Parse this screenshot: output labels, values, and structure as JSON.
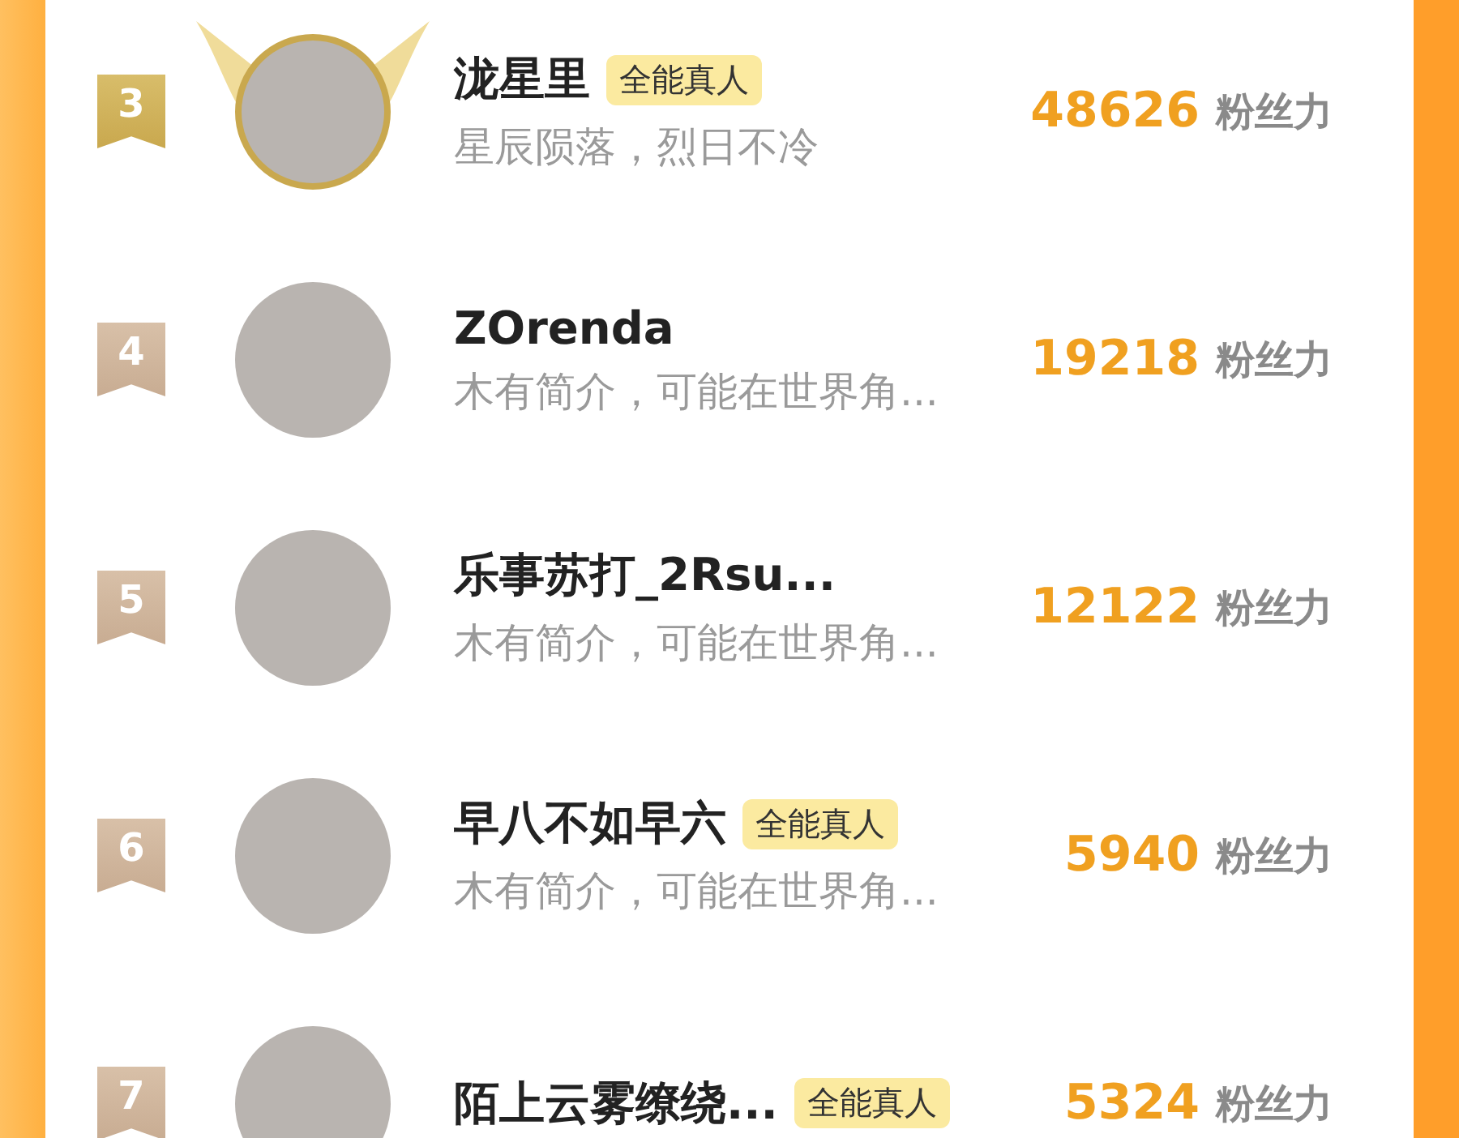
{
  "ranking": [
    {
      "rank": "3",
      "kind": "crowned",
      "name": "泷星里",
      "tag": "全能真人",
      "bio": "星辰陨落，烈日不冷",
      "score": "48626",
      "unit": "粉丝力"
    },
    {
      "rank": "4",
      "kind": "plain",
      "name": "ZOrenda",
      "bio": "木有简介，可能在世界角...",
      "score": "19218",
      "unit": "粉丝力"
    },
    {
      "rank": "5",
      "kind": "plain",
      "name": "乐事苏打_2Rsu...",
      "bio": "木有简介，可能在世界角...",
      "score": "12122",
      "unit": "粉丝力"
    },
    {
      "rank": "6",
      "kind": "plain",
      "name": "早八不如早六",
      "tag": "全能真人",
      "bio": "木有简介，可能在世界角...",
      "score": "5940",
      "unit": "粉丝力"
    },
    {
      "rank": "7",
      "kind": "plain",
      "name": "陌上云雾缭绕...",
      "tag": "全能真人",
      "score": "5324",
      "unit": "粉丝力"
    }
  ]
}
